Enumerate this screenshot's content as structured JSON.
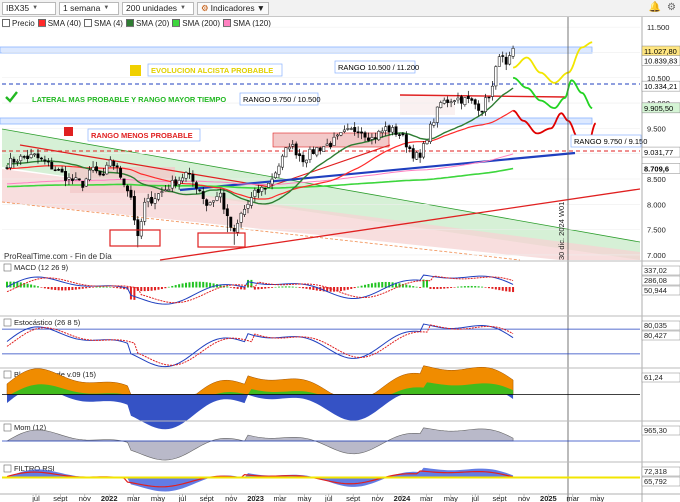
{
  "toolbar": {
    "symbol": "IBX35",
    "timeframe": "1 semana",
    "units": "200 unidades",
    "indicators_btn": "Indicadores",
    "bell_icon": "bell-icon",
    "settings_icon": "gear-icon"
  },
  "legend": [
    {
      "label": "Precio",
      "color": "#ffffff"
    },
    {
      "label": "SMA (40)",
      "color": "#ff2a2a"
    },
    {
      "label": "SMA (4)",
      "color": "#ffffff"
    },
    {
      "label": "SMA (20)",
      "color": "#2e7d32"
    },
    {
      "label": "SMA (200)",
      "color": "#3dd63d"
    },
    {
      "label": "SMA (120)",
      "color": "#ff80c0"
    }
  ],
  "colors": {
    "price": "#000000",
    "sma40": "#ff2a2a",
    "sma20": "#2e7d32",
    "sma200": "#3dd63d",
    "sma120": "#ff80c0",
    "trend_blue": "#1f3fbf",
    "support_red": "#e02020",
    "forecast_yellow": "#f2e600",
    "forecast_green": "#22d322",
    "forecast_red": "#e00000",
    "channel_green": "#c8ebc8",
    "channel_pink": "#f6d3d3",
    "band_blue": "#dde9ff"
  },
  "main": {
    "watermark": "ProRealTime.com - Fin de Día",
    "annotations": {
      "alcista": "EVOLUCION ALCISTA PROBABLE",
      "lateral": "LATERAL MAS PROBABLE Y RANGO MAYOR TIEMPO",
      "rango_menos": "RANGO MENOS PROBABLE",
      "rango1": "RANGO 10.500 / 11.200",
      "rango2": "RANGO 9.750 / 10.500",
      "rango3": "RANGO 9.750 / 9.150",
      "cursor_date": "30 dic. 2024 W01"
    },
    "price_tags": [
      {
        "label": "11.027,80",
        "value": 11027.8,
        "color": "#ffe680"
      },
      {
        "label": "10.839,83",
        "value": 10839.83,
        "color": "#ffffff"
      },
      {
        "label": "10.334,21",
        "value": 10334.21,
        "color": "#ffffff"
      },
      {
        "label": "9.905,50",
        "value": 9905.5,
        "color": "#d5f5d5"
      },
      {
        "label": "9.031,77",
        "value": 9031.77,
        "color": "#ffffff"
      },
      {
        "label": "8.709,6",
        "value": 8709.6,
        "color": "#ffffff"
      }
    ]
  },
  "subpanels": [
    {
      "id": "macd",
      "label": "MACD (12 26 9)",
      "tags": [
        "337,02",
        "286,08",
        "50,944"
      ]
    },
    {
      "id": "esto",
      "label": "Estocástico (26 8 5)",
      "tags": [
        "80,035",
        "80,427"
      ]
    },
    {
      "id": "blai5",
      "label": "Blai5 Koncorde v.09 (15)",
      "tags": [
        "61,24"
      ]
    },
    {
      "id": "mom",
      "label": "Mom (12)",
      "tags": [
        "965,30"
      ]
    },
    {
      "id": "rsi",
      "label": "FILTRO RSI",
      "tags": [
        "72,318",
        "65,792"
      ]
    }
  ],
  "chart_data": {
    "type": "line",
    "title": "IBX35",
    "x_ticks": [
      "jul",
      "sept",
      "nov",
      "2022",
      "mar",
      "may",
      "jul",
      "sept",
      "nov",
      "2023",
      "mar",
      "may",
      "jul",
      "sept",
      "nov",
      "2024",
      "mar",
      "may",
      "jul",
      "sept",
      "nov",
      "2025",
      "mar",
      "may"
    ],
    "ylim": [
      6900,
      11700
    ],
    "y_ticks": [
      7000,
      7500,
      8000,
      8500,
      9000,
      9500,
      10000,
      10500,
      11000,
      11500
    ],
    "y_tick_labels": [
      "7.000",
      "7.500",
      "8.000",
      "8.500",
      "9.000",
      "9.500",
      "10.000",
      "10.500",
      "11.000",
      "11.500"
    ],
    "series": [
      {
        "name": "Precio",
        "type": "candles",
        "period": "weekly",
        "start": "2021-06-07",
        "end": "2024-05-06",
        "anchors": [
          [
            0,
            8800
          ],
          [
            3,
            8900
          ],
          [
            8,
            8950
          ],
          [
            14,
            8700
          ],
          [
            18,
            8500
          ],
          [
            22,
            8400
          ],
          [
            25,
            8700
          ],
          [
            28,
            8500
          ],
          [
            30,
            8900
          ],
          [
            34,
            8450
          ],
          [
            36,
            8150
          ],
          [
            38,
            7300
          ],
          [
            40,
            8000
          ],
          [
            44,
            8200
          ],
          [
            48,
            8400
          ],
          [
            52,
            8600
          ],
          [
            56,
            8300
          ],
          [
            58,
            8000
          ],
          [
            62,
            8200
          ],
          [
            64,
            7700
          ],
          [
            66,
            7400
          ],
          [
            68,
            7800
          ],
          [
            72,
            8200
          ],
          [
            76,
            8400
          ],
          [
            80,
            8900
          ],
          [
            82,
            9200
          ],
          [
            86,
            8900
          ],
          [
            90,
            9100
          ],
          [
            94,
            9200
          ],
          [
            98,
            9400
          ],
          [
            102,
            9500
          ],
          [
            106,
            9300
          ],
          [
            110,
            9500
          ],
          [
            114,
            9400
          ],
          [
            118,
            9000
          ],
          [
            120,
            8900
          ],
          [
            122,
            9350
          ],
          [
            126,
            10000
          ],
          [
            130,
            10100
          ],
          [
            134,
            10050
          ],
          [
            138,
            9900
          ],
          [
            141,
            10300
          ],
          [
            143,
            11000
          ],
          [
            145,
            10700
          ],
          [
            147,
            11000
          ]
        ]
      },
      {
        "name": "SMA (4)",
        "type": "line",
        "period": 4
      },
      {
        "name": "SMA (20)",
        "type": "line",
        "period": 20
      },
      {
        "name": "SMA (40)",
        "type": "line",
        "period": 40
      },
      {
        "name": "SMA (120)",
        "type": "line",
        "period": 120
      },
      {
        "name": "SMA (200)",
        "type": "line",
        "period": 200
      },
      {
        "name": "EVOLUCION ALCISTA PROBABLE",
        "type": "forecast",
        "anchors": [
          [
            147,
            10700
          ],
          [
            151,
            10900
          ],
          [
            155,
            10600
          ],
          [
            159,
            10400
          ],
          [
            163,
            10600
          ],
          [
            167,
            11100
          ],
          [
            170,
            11200
          ]
        ]
      },
      {
        "name": "LATERAL MAS PROBABLE Y RANGO MAYOR TIEMPO",
        "type": "forecast",
        "anchors": [
          [
            147,
            10500
          ],
          [
            151,
            10300
          ],
          [
            155,
            10050
          ],
          [
            159,
            9900
          ],
          [
            162,
            10100
          ],
          [
            164,
            10450
          ],
          [
            167,
            10200
          ],
          [
            170,
            9900
          ]
        ]
      },
      {
        "name": "RANGO MENOS PROBABLE",
        "type": "forecast",
        "anchors": [
          [
            147,
            9850
          ],
          [
            150,
            9650
          ],
          [
            154,
            9400
          ],
          [
            158,
            9500
          ],
          [
            161,
            9800
          ],
          [
            163,
            9650
          ],
          [
            166,
            9300
          ],
          [
            169,
            9250
          ],
          [
            171,
            9600
          ]
        ]
      }
    ],
    "levels": [
      {
        "name": "RANGO 10.500 / 11.200",
        "values": [
          10500,
          11200
        ]
      },
      {
        "name": "RANGO 9.750 / 10.500",
        "values": [
          9750,
          10500
        ]
      },
      {
        "name": "RANGO 9.750 / 9.150",
        "values": [
          9750,
          9150
        ]
      }
    ]
  }
}
